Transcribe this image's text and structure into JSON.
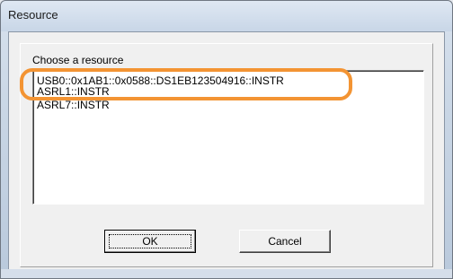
{
  "window": {
    "title": "Resource"
  },
  "dialog": {
    "prompt": "Choose a resource",
    "resources": [
      "USB0::0x1AB1::0x0588::DS1EB123504916::INSTR",
      "ASRL1::INSTR",
      "ASRL7::INSTR"
    ],
    "ok_label": "OK",
    "cancel_label": "Cancel"
  },
  "annotation": {
    "color": "#f39433"
  }
}
